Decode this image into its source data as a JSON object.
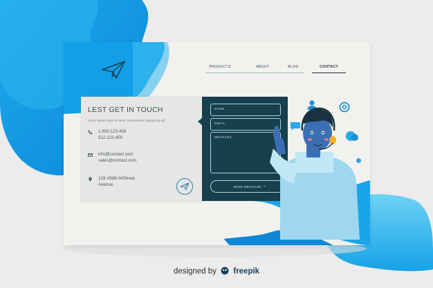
{
  "nav": {
    "products": "PRODUCTS",
    "about": "ABOUT",
    "blog": "BLOG",
    "contact": "CONTACT"
  },
  "contact_card": {
    "title": "LEST GET IN TOUCH",
    "description": "Lorem ipsum dolor sit amet, consectetuer adipiscing elit.",
    "phone_1": "1.800.123.456",
    "phone_2": "512.123.456",
    "email_1": "info@contact.com",
    "email_2": "sales@contact.com",
    "address_1": "129 #56B-04Street.",
    "address_2": "Avenue."
  },
  "form": {
    "name_placeholder": "NAME",
    "email_placeholder": "EMAIL",
    "message_placeholder": "MESSAGE",
    "send_label": "SEND MESSAGE"
  },
  "footer": {
    "prefix": "designed by",
    "brand": "freepik"
  },
  "colors": {
    "blob_dark": "#0f8fd8",
    "blob_light": "#53c8f2",
    "panel_dark": "#17404e",
    "page_bg": "#f1f1ee",
    "accent": "#2f7ea8"
  },
  "icons": [
    "paper-plane-icon",
    "phone-icon",
    "mail-icon",
    "location-pin-icon",
    "send-icon",
    "user-icon",
    "at-icon",
    "chat-bubble-icon",
    "headset-icon",
    "arrow-right-icon"
  ]
}
